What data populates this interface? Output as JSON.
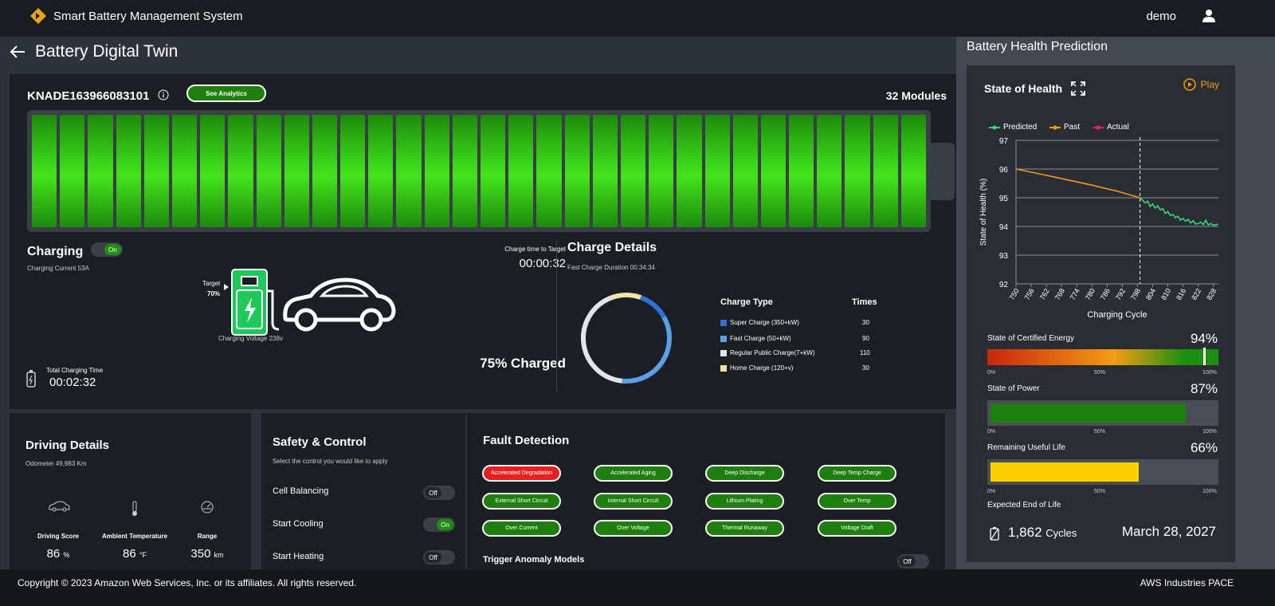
{
  "header": {
    "app_title": "Smart Battery Management System",
    "user": "demo"
  },
  "page": {
    "title": "Battery Digital Twin"
  },
  "battery": {
    "serial": "KNADE163966083101",
    "see_analytics": "See Analytics",
    "modules_label": "32 Modules",
    "module_count": 32,
    "cell_color": "#3dd81a"
  },
  "charging": {
    "label": "Charging",
    "toggle": "On",
    "current": "Charging Current 53A",
    "target_label": "Target",
    "target_value": "70%",
    "voltage": "Charging Voltage 238v",
    "time_to_target_label": "Charge time to Target",
    "time_to_target": "00:00:32",
    "charged": "75% Charged",
    "total_label": "Total Charging Time",
    "total_time": "00:02:32",
    "charger_color": "#1ec95a"
  },
  "charge_details": {
    "title": "Charge Details",
    "fast_duration": "Fast Charge Duration 00:34:34",
    "type_header": "Charge Type",
    "times_header": "Times",
    "types": [
      {
        "label": "Super Charge (350+kW)",
        "times": "30",
        "color": "#2f6fd6"
      },
      {
        "label": "Fast Charge (50+kW)",
        "times": "90",
        "color": "#5b9eea"
      },
      {
        "label": "Regular Public Charge(7+kW)",
        "times": "110",
        "color": "#dde6ea"
      },
      {
        "label": "Home Charge (120+v)",
        "times": "30",
        "color": "#efe3a8"
      }
    ]
  },
  "driving": {
    "title": "Driving Details",
    "odometer": "Odometer 49,983 Km",
    "score_label": "Driving Score",
    "score": "86",
    "score_unit": "%",
    "temp_label": "Ambient Temperature",
    "temp": "86",
    "temp_unit": "°F",
    "range_label": "Range",
    "range": "350",
    "range_unit": "km"
  },
  "safety": {
    "title": "Safety & Control",
    "subtitle": "Select the control you would like to apply",
    "controls": [
      {
        "label": "Cell Balancing",
        "state": "Off"
      },
      {
        "label": "Start Cooling",
        "state": "On"
      },
      {
        "label": "Start Heating",
        "state": "Off"
      }
    ]
  },
  "faults": {
    "title": "Fault Detection",
    "items": [
      "Accelerated Degradation",
      "Accelerated Aging",
      "Deep Discharge",
      "Deep Temp Charge",
      "External Short Circuit",
      "Internal Short Circuit",
      "Lithium Plating",
      "Over Temp",
      "Over Current",
      "Over Voltage",
      "Thermal Runaway",
      "Voltage Draft"
    ],
    "trigger_label": "Trigger Anomaly Models",
    "trigger_state": "Off"
  },
  "prediction": {
    "title": "Battery Health Prediction",
    "soh_title": "State of Health",
    "play": "Play",
    "legend": {
      "predicted": "Predicted",
      "past": "Past",
      "actual": "Actual"
    },
    "predicted_color": "#3ad47e",
    "past_color": "#f39c12",
    "actual_color": "#e0245e",
    "certified_energy_label": "State of Certified Energy",
    "certified_energy": "94%",
    "certified_energy_fraction": 0.94,
    "power_label": "State of Power",
    "power": "87%",
    "power_fraction": 0.87,
    "rul_label": "Remaining Useful Life",
    "rul": "66%",
    "rul_fraction": 0.66,
    "scale": {
      "min": "0%",
      "mid": "50%",
      "max": "100%"
    },
    "eol_label": "Expected End of Life",
    "cycles": "1,862",
    "cycles_unit": "Cycles",
    "eol_date": "March 28, 2027"
  },
  "chart_data": {
    "type": "line",
    "xlabel": "Charging Cycle",
    "ylabel": "State of Health (%)",
    "ylim": [
      92,
      97
    ],
    "y_ticks": [
      92,
      93,
      94,
      95,
      96,
      97
    ],
    "x_ticks": [
      750,
      756,
      762,
      768,
      774,
      780,
      786,
      792,
      798,
      804,
      810,
      816,
      822,
      828
    ],
    "marker_x": 799,
    "series": [
      {
        "name": "Past",
        "x": [
          750,
          760,
          770,
          780,
          790,
          799
        ],
        "y": [
          96.0,
          95.82,
          95.63,
          95.44,
          95.23,
          95.0
        ]
      },
      {
        "name": "Predicted",
        "x": [
          799,
          800,
          801,
          802,
          803,
          804,
          805,
          806,
          807,
          808,
          809,
          810,
          811,
          812,
          813,
          814,
          815,
          816,
          817,
          818,
          819,
          820,
          821,
          822,
          823,
          824,
          825,
          826,
          827,
          828,
          829,
          830
        ],
        "y": [
          95.0,
          94.92,
          94.82,
          94.88,
          94.7,
          94.78,
          94.64,
          94.72,
          94.58,
          94.62,
          94.45,
          94.52,
          94.38,
          94.42,
          94.3,
          94.36,
          94.22,
          94.28,
          94.18,
          94.25,
          94.12,
          94.2,
          94.08,
          94.1,
          94.15,
          94.06,
          94.22,
          94.05,
          94.1,
          94.04,
          94.06,
          94.08
        ]
      },
      {
        "name": "Actual",
        "x": [],
        "y": []
      }
    ]
  }
}
